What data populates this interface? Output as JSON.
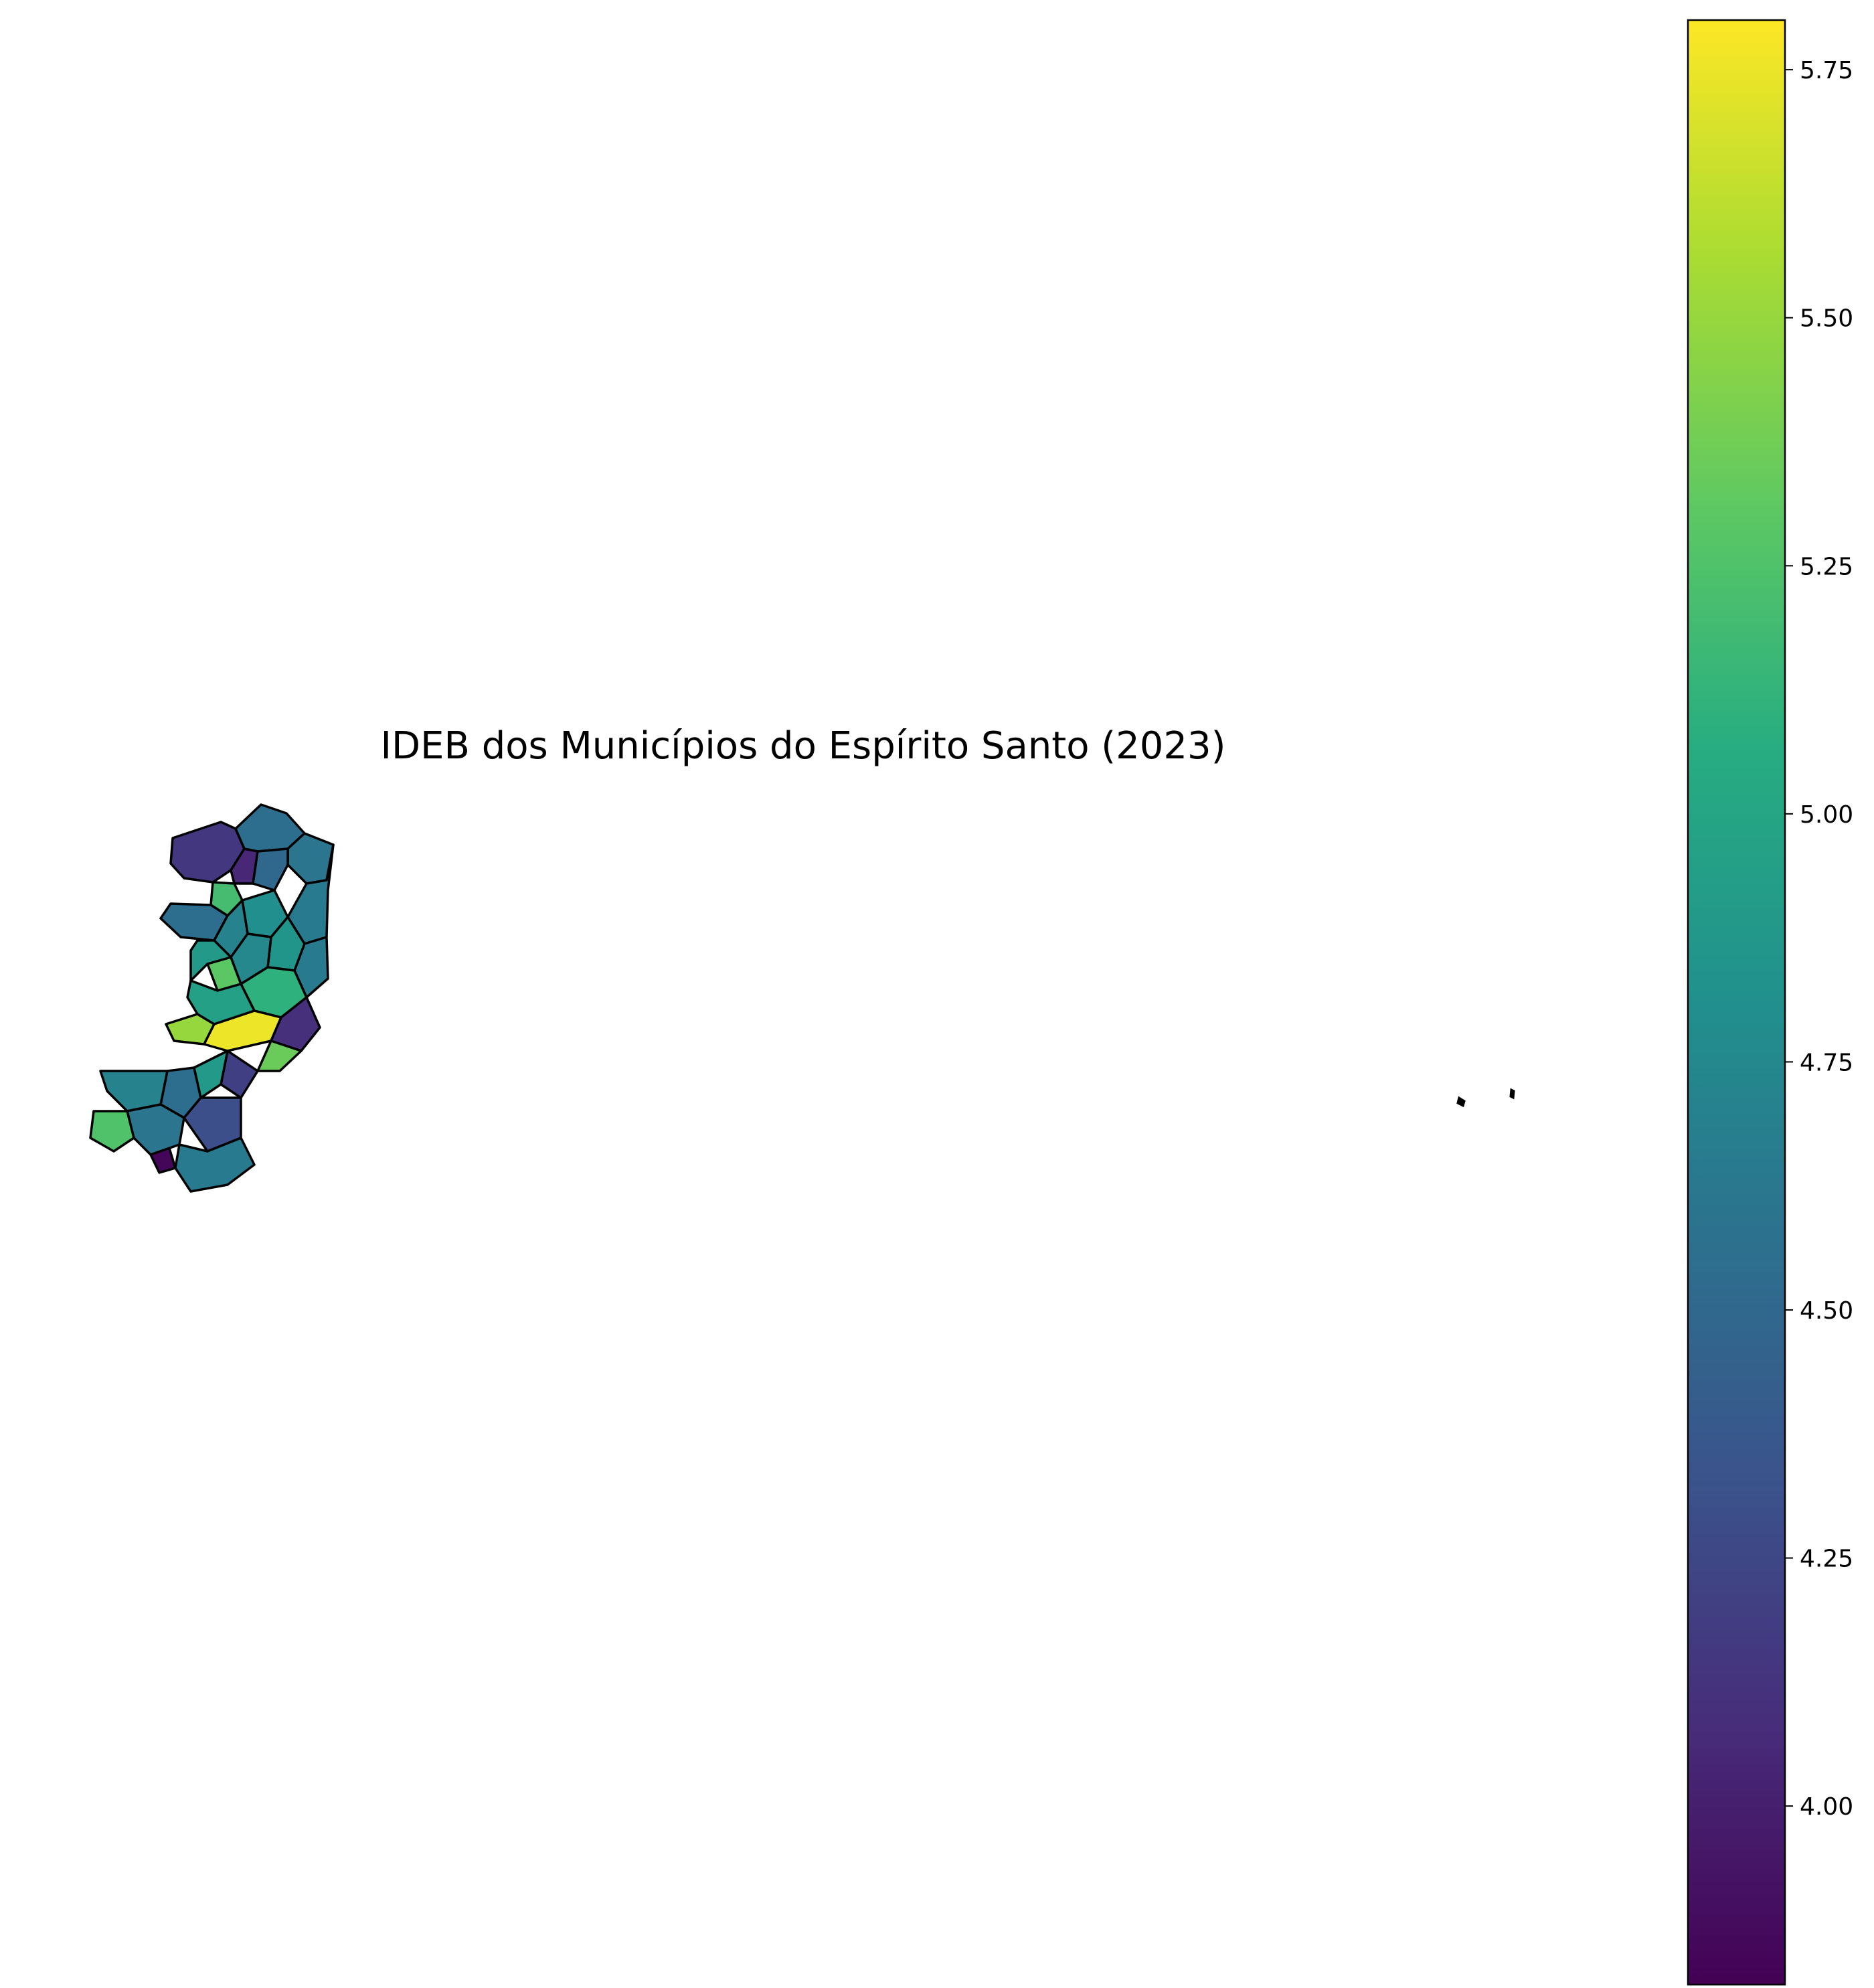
{
  "title": "IDEB dos Municípios do Espírito Santo (2023)",
  "colorbar": {
    "colormap": "viridis",
    "min": 3.82,
    "max": 5.8,
    "ticks": [
      "4.00",
      "4.25",
      "4.50",
      "4.75",
      "5.00",
      "5.25",
      "5.50",
      "5.75"
    ]
  },
  "map": {
    "region": "Espírito Santo",
    "edge_color": "#000000",
    "municipality_values": [
      4.15,
      4.55,
      4.6,
      4.05,
      5.2,
      4.5,
      4.65,
      4.8,
      4.55,
      4.7,
      4.85,
      5.3,
      4.65,
      4.9,
      4.75,
      5.1,
      5.5,
      5.75,
      4.1,
      4.95,
      5.35,
      4.55,
      4.2,
      4.9,
      4.7,
      3.85,
      4.6,
      5.25,
      4.3,
      4.65
    ],
    "islands": "Trindade e Martim Vaz"
  }
}
